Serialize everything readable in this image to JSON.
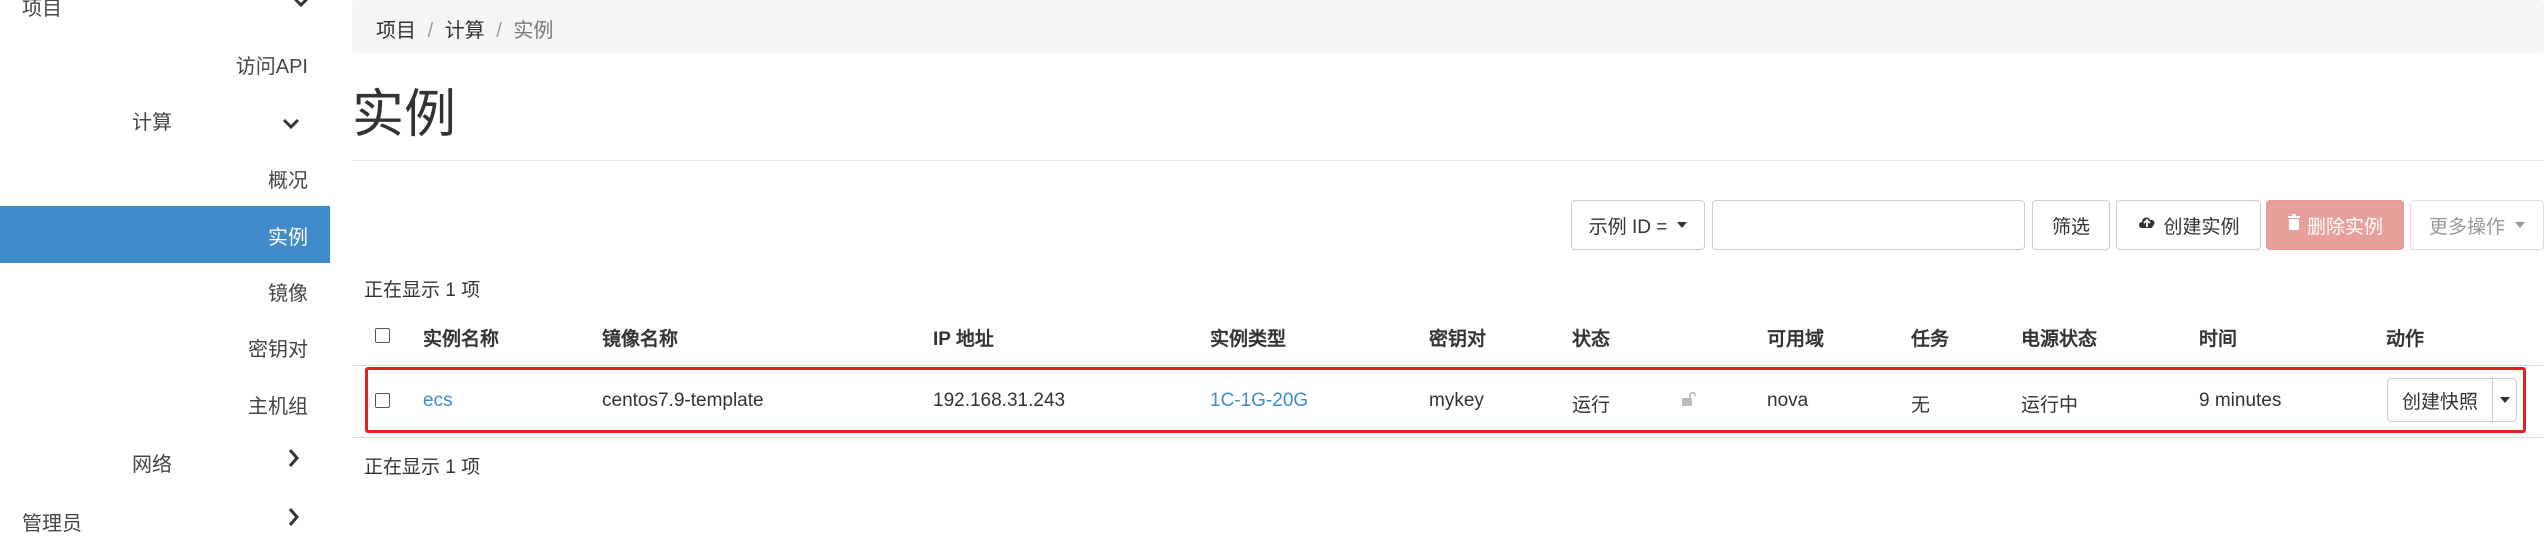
{
  "sidebar": {
    "project": "项目",
    "access_api": "访问API",
    "compute": "计算",
    "overview": "概况",
    "instances": "实例",
    "images": "镜像",
    "keypairs": "密钥对",
    "host_groups": "主机组",
    "network": "网络",
    "admin": "管理员"
  },
  "breadcrumb": {
    "items": [
      "项目",
      "计算",
      "实例"
    ],
    "separator": "/"
  },
  "page": {
    "title": "实例"
  },
  "toolbar": {
    "filter_select": "示例 ID =",
    "filter_input_value": "",
    "filter_button": "筛选",
    "create_button": "创建实例",
    "delete_button": "删除实例",
    "more_button": "更多操作"
  },
  "summary": {
    "top": "正在显示 1 项",
    "bottom": "正在显示 1 项"
  },
  "table": {
    "headers": {
      "name": "实例名称",
      "image": "镜像名称",
      "ip": "IP 地址",
      "flavor": "实例类型",
      "keypair": "密钥对",
      "status": "状态",
      "az": "可用域",
      "task": "任务",
      "power": "电源状态",
      "time": "时间",
      "actions": "动作"
    },
    "rows": [
      {
        "name": "ecs",
        "image": "centos7.9-template",
        "ip": "192.168.31.243",
        "flavor": "1C-1G-20G",
        "keypair": "mykey",
        "status": "运行",
        "az": "nova",
        "task": "无",
        "power": "运行中",
        "time": "9 minutes",
        "action": "创建快照"
      }
    ]
  },
  "colors": {
    "accent": "#428bca",
    "danger": "#e8a09d",
    "highlight": "#e5201b"
  }
}
